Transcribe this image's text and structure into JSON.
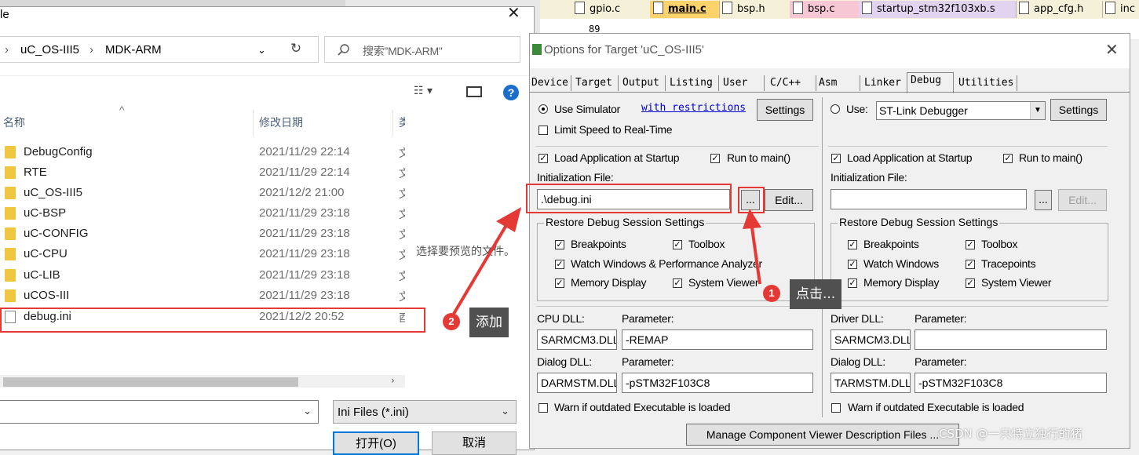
{
  "ide": {
    "tabs": [
      "gpio.c",
      "main.c",
      "bsp.h",
      "bsp.c",
      "startup_stm32f103xb.s",
      "app_cfg.h",
      "inc"
    ],
    "line_number": "89"
  },
  "file_dialog": {
    "title": "le",
    "breadcrumb": [
      "uC_OS-III5",
      "MDK-ARM"
    ],
    "search_placeholder": "搜索\"MDK-ARM\"",
    "columns": {
      "name": "名称",
      "date": "修改日期",
      "type": "类"
    },
    "files": [
      {
        "name": "DebugConfig",
        "date": "2021/11/29 22:14",
        "kind": "folder"
      },
      {
        "name": "RTE",
        "date": "2021/11/29 22:14",
        "kind": "folder"
      },
      {
        "name": "uC_OS-III5",
        "date": "2021/12/2 21:00",
        "kind": "folder"
      },
      {
        "name": "uC-BSP",
        "date": "2021/11/29 23:18",
        "kind": "folder"
      },
      {
        "name": "uC-CONFIG",
        "date": "2021/11/29 23:18",
        "kind": "folder"
      },
      {
        "name": "uC-CPU",
        "date": "2021/11/29 23:18",
        "kind": "folder"
      },
      {
        "name": "uC-LIB",
        "date": "2021/11/29 23:18",
        "kind": "folder"
      },
      {
        "name": "uCOS-III",
        "date": "2021/11/29 23:18",
        "kind": "folder"
      },
      {
        "name": "debug.ini",
        "date": "2021/12/2 20:52",
        "kind": "file"
      }
    ],
    "preview_text": "选择要预览的文件。",
    "filename_value": "",
    "filter_value": "Ini Files (*.ini)",
    "open_label": "打开(O)",
    "cancel_label": "取消"
  },
  "options": {
    "title": "Options for Target 'uC_OS-III5'",
    "tabs": [
      "Device",
      "Target",
      "Output",
      "Listing",
      "User",
      "C/C++",
      "Asm",
      "Linker",
      "Debug",
      "Utilities"
    ],
    "active_tab": "Debug",
    "left": {
      "use_simulator": "Use Simulator",
      "with_restrictions": "with restrictions",
      "settings_label": "Settings",
      "limit_speed": "Limit Speed to Real-Time",
      "load_app": "Load Application at Startup",
      "run_to_main": "Run to main()",
      "init_file_label": "Initialization File:",
      "init_file_value": ".\\debug.ini",
      "browse_label": "...",
      "edit_label": "Edit...",
      "restore_caption": "Restore Debug Session Settings",
      "breakpoints": "Breakpoints",
      "toolbox": "Toolbox",
      "watch_windows": "Watch Windows & Performance Analyzer",
      "memory_display": "Memory Display",
      "system_viewer": "System Viewer",
      "cpu_dll_label": "CPU DLL:",
      "param_label": "Parameter:",
      "cpu_dll": "SARMCM3.DLL",
      "cpu_param": "-REMAP",
      "dialog_dll_label": "Dialog DLL:",
      "dialog_dll": "DARMSTM.DLL",
      "dialog_param": "-pSTM32F103C8",
      "warn": "Warn if outdated Executable is loaded"
    },
    "right": {
      "use_label": "Use:",
      "debugger": "ST-Link Debugger",
      "settings_label": "Settings",
      "load_app": "Load Application at Startup",
      "run_to_main": "Run to main()",
      "init_file_label": "Initialization File:",
      "init_file_value": "",
      "browse_label": "...",
      "edit_label": "Edit...",
      "restore_caption": "Restore Debug Session Settings",
      "breakpoints": "Breakpoints",
      "toolbox": "Toolbox",
      "watch_windows": "Watch Windows",
      "tracepoints": "Tracepoints",
      "memory_display": "Memory Display",
      "system_viewer": "System Viewer",
      "driver_dll_label": "Driver DLL:",
      "param_label": "Parameter:",
      "driver_dll": "SARMCM3.DLL",
      "driver_param": "",
      "dialog_dll_label": "Dialog DLL:",
      "dialog_dll": "TARMSTM.DLL",
      "dialog_param": "-pSTM32F103C8",
      "warn": "Warn if outdated Executable is loaded"
    },
    "manage_button": "Manage Component Viewer Description Files ..."
  },
  "annotations": {
    "step1_number": "1",
    "step1_text": "点击...",
    "step2_number": "2",
    "step2_text": "添加",
    "highlight_color": "#e53935"
  },
  "watermark": "CSDN @一只特立独行的猪"
}
